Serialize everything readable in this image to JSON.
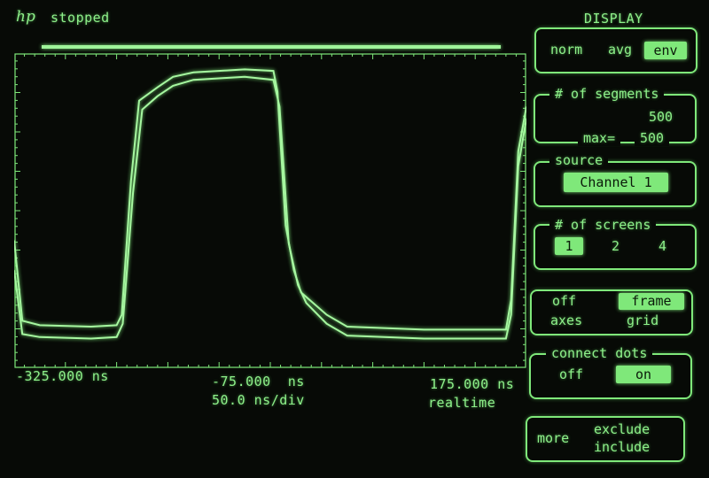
{
  "header": {
    "logo": "hp",
    "status": "stopped",
    "panel_title": "DISPLAY"
  },
  "readout": {
    "left_time": "-325.000 ns",
    "center_time": "-75.000  ns",
    "timebase": "50.0 ns/div",
    "right_time": "175.000 ns",
    "mode": "realtime"
  },
  "menu": {
    "mode": {
      "options": [
        "norm",
        "avg",
        "env"
      ],
      "selected": "env"
    },
    "segments": {
      "title": "# of segments",
      "value": "500",
      "max_label": "max=",
      "max_value": "500"
    },
    "source": {
      "title": "source",
      "value": "Channel 1"
    },
    "screens": {
      "title": "# of screens",
      "options": [
        "1",
        "2",
        "4"
      ],
      "selected": "1"
    },
    "axes_grid": {
      "top_left": "off",
      "top_right": "frame",
      "bottom_left": "axes",
      "bottom_right": "grid",
      "selected": "frame"
    },
    "connect_dots": {
      "title": "connect dots",
      "off_label": "off",
      "on_label": "on",
      "selected": "on"
    },
    "more": {
      "label": "more",
      "exclude": "exclude",
      "include": "include"
    }
  },
  "colors": {
    "phosphor": "#8ef08a",
    "trace": "#a6f7a0",
    "background": "#070a06"
  },
  "waveform": {
    "x_range_ns": [
      -325,
      175
    ],
    "time_per_div_ns": 50,
    "envelope_upper": [
      [
        -325,
        -0.2
      ],
      [
        -317,
        -0.74
      ],
      [
        -300,
        -0.77
      ],
      [
        -250,
        -0.78
      ],
      [
        -225,
        -0.77
      ],
      [
        -220,
        -0.7
      ],
      [
        -211,
        0.2
      ],
      [
        -203,
        0.74
      ],
      [
        -185,
        0.83
      ],
      [
        -170,
        0.9
      ],
      [
        -150,
        0.93
      ],
      [
        -100,
        0.95
      ],
      [
        -72,
        0.94
      ],
      [
        -68,
        0.8
      ],
      [
        -60,
        -0.1
      ],
      [
        -52,
        -0.4
      ],
      [
        -45,
        -0.55
      ],
      [
        -20,
        -0.7
      ],
      [
        0,
        -0.78
      ],
      [
        75,
        -0.8
      ],
      [
        155,
        -0.8
      ],
      [
        160,
        -0.6
      ],
      [
        167,
        0.4
      ],
      [
        175,
        0.7
      ]
    ],
    "envelope_lower": [
      [
        -325,
        -0.4
      ],
      [
        -317,
        -0.83
      ],
      [
        -300,
        -0.85
      ],
      [
        -250,
        -0.86
      ],
      [
        -225,
        -0.85
      ],
      [
        -219,
        -0.76
      ],
      [
        -209,
        0.12
      ],
      [
        -200,
        0.68
      ],
      [
        -185,
        0.77
      ],
      [
        -170,
        0.84
      ],
      [
        -150,
        0.88
      ],
      [
        -100,
        0.9
      ],
      [
        -72,
        0.88
      ],
      [
        -66,
        0.7
      ],
      [
        -57,
        -0.22
      ],
      [
        -48,
        -0.5
      ],
      [
        -40,
        -0.62
      ],
      [
        -20,
        -0.76
      ],
      [
        0,
        -0.84
      ],
      [
        75,
        -0.86
      ],
      [
        155,
        -0.86
      ],
      [
        160,
        -0.7
      ],
      [
        167,
        0.3
      ],
      [
        175,
        0.62
      ]
    ]
  }
}
